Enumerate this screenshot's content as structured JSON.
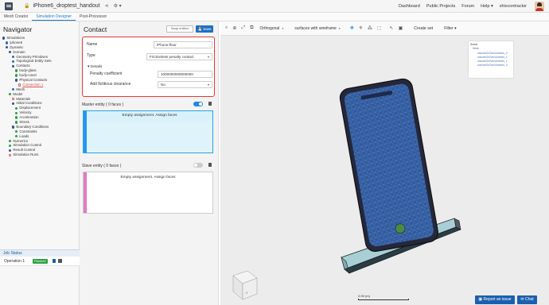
{
  "topbar": {
    "title": "iPhone6_droptest_handout",
    "links": [
      "Dashboard",
      "Public Projects",
      "Forum",
      "Help ▾",
      "shivcontractor"
    ]
  },
  "tabs": [
    "Mesh Creator",
    "Simulation Designer",
    "Post-Processor"
  ],
  "navigator": {
    "title": "Navigator",
    "tree": [
      {
        "label": "Simulations",
        "level": 0,
        "mark": "navy"
      },
      {
        "label": "iphone6",
        "level": 1,
        "mark": "blue"
      },
      {
        "label": "Dynamic",
        "level": 1,
        "mark": "navy"
      },
      {
        "label": "Domain",
        "level": 2,
        "mark": "navy"
      },
      {
        "label": "Geometry Primitives",
        "level": 3,
        "mark": "blue"
      },
      {
        "label": "Topological Entity Sets",
        "level": 3,
        "mark": "blue"
      },
      {
        "label": "Contacts",
        "level": 3,
        "mark": "navy"
      },
      {
        "label": "body-glass",
        "level": 4,
        "mark": "green"
      },
      {
        "label": "body-cover",
        "level": 4,
        "mark": "green"
      },
      {
        "label": "Physical Contacts",
        "level": 4,
        "mark": "navy"
      },
      {
        "label": "Connection 1",
        "level": 5,
        "mark": "ring",
        "selected": true
      },
      {
        "label": "Mesh",
        "level": 3,
        "mark": "blue"
      },
      {
        "label": "Model",
        "level": 2,
        "mark": "green"
      },
      {
        "label": "Materials",
        "level": 3,
        "mark": "ring"
      },
      {
        "label": "Initial Conditions",
        "level": 3,
        "mark": "navy"
      },
      {
        "label": "Displacement",
        "level": 4,
        "mark": "green"
      },
      {
        "label": "Velocity",
        "level": 4,
        "mark": "green"
      },
      {
        "label": "Acceleration",
        "level": 4,
        "mark": "green"
      },
      {
        "label": "Stress",
        "level": 4,
        "mark": "green"
      },
      {
        "label": "Boundary Conditions",
        "level": 3,
        "mark": "navy"
      },
      {
        "label": "Constraints",
        "level": 4,
        "mark": "green"
      },
      {
        "label": "Loads",
        "level": 4,
        "mark": "green"
      },
      {
        "label": "Numerics",
        "level": 2,
        "mark": "green"
      },
      {
        "label": "Simulation Control",
        "level": 2,
        "mark": "green"
      },
      {
        "label": "Result Control",
        "level": 2,
        "mark": "navy"
      },
      {
        "label": "Simulation Runs",
        "level": 2,
        "mark": "ring"
      }
    ],
    "job_status": {
      "title": "Job Status",
      "operation": "Operation 1",
      "state": "Finished"
    }
  },
  "contact_panel": {
    "title": "Contact",
    "swap_label": "Swap entities",
    "save_label": "Save",
    "name_label": "Name",
    "name_value": "iPhone-floor",
    "type_label": "Type",
    "type_value": "Frictionless penalty contact",
    "details_label": "▾ Details",
    "penalty_label": "Penalty coefficient",
    "penalty_value": "1000000000000000",
    "clearance_label": "Add fictitious clearance",
    "clearance_value": "No",
    "master_label": "Master entity   ( 0 faces )",
    "master_assign": "Empty assignment. Assign faces",
    "slave_label": "Slave entity   ( 0 faces )",
    "slave_assign": "Empty assignment. Assign faces"
  },
  "viewer": {
    "projection": "Orthogonal",
    "render_mode": "surfaces with wireframe",
    "create_set": "Create set",
    "filter": "Filter ▾",
    "scene": {
      "rows": [
        "Scene",
        "Mesh",
        "volumeOnGeoVolumes_0",
        "volumeOnGeoVolumes_1",
        "volumeOnGeoVolumes_2",
        "volumeOnGeoVolumes_3"
      ]
    },
    "scale": "0.05 (m)",
    "report_label": "Report an issue",
    "chat_label": "Chat"
  },
  "colors": {
    "accent": "#1e88e5",
    "highlight": "#e53935",
    "phone_screen": "#2f5a9e",
    "floor": "#9fc8d0"
  }
}
